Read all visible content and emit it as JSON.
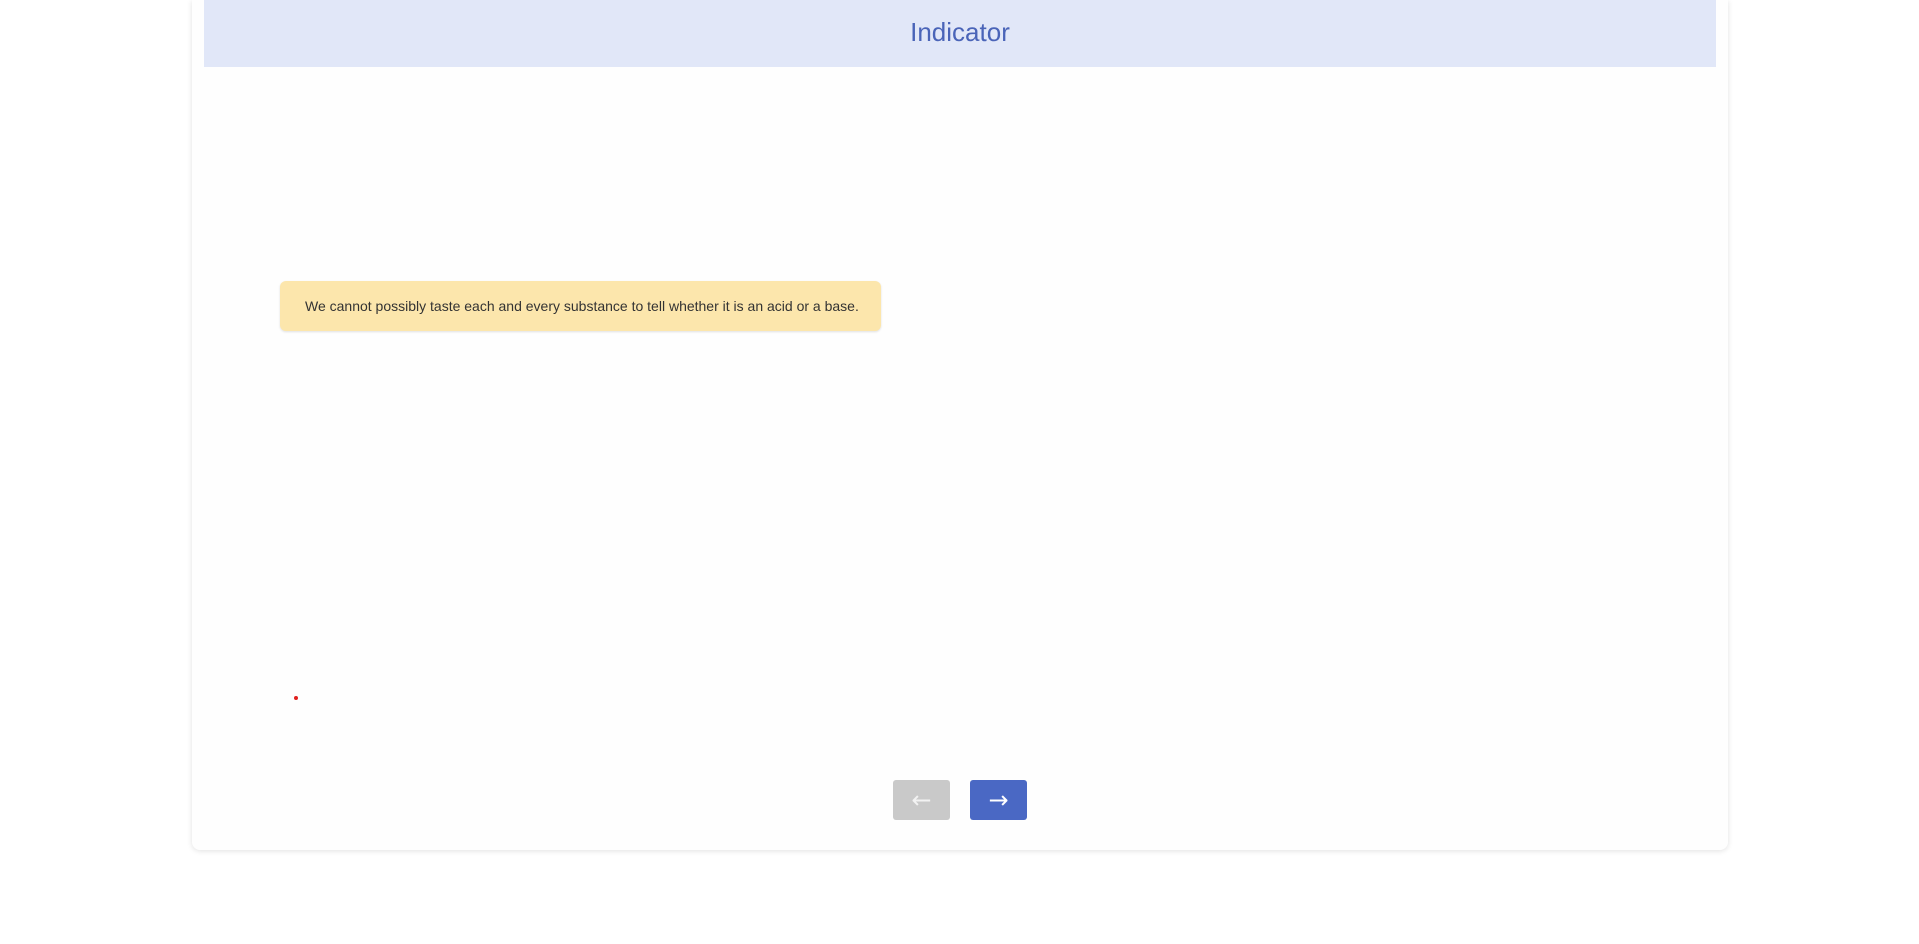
{
  "header": {
    "title": "Indicator"
  },
  "content": {
    "note_text": "We cannot possibly taste each and every substance to tell whether it is an acid or a base."
  },
  "navigation": {
    "prev_label": "←",
    "next_label": "→",
    "prev_enabled": false,
    "next_enabled": true
  },
  "colors": {
    "header_bg": "#e1e7f8",
    "title": "#4a64b8",
    "note_bg": "#fce6ac",
    "next_bg": "#4a68c4",
    "prev_bg": "#c9c9c9",
    "dot": "#e0201e"
  }
}
